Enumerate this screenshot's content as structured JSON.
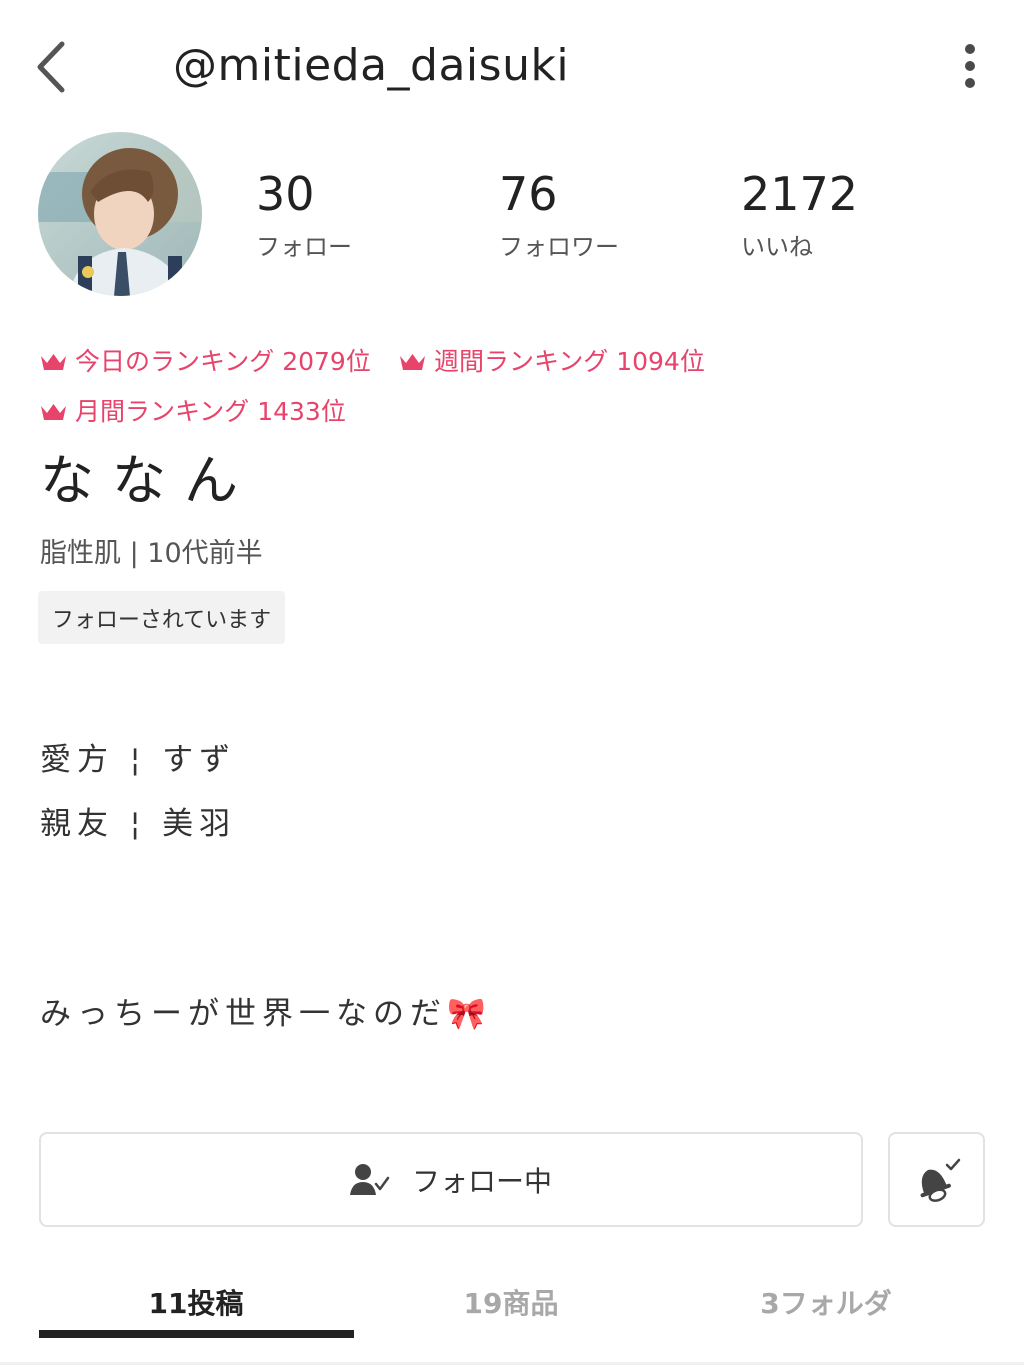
{
  "header": {
    "handle": "@mitieda_daisuki",
    "back_icon": "chevron-left-icon",
    "more_icon": "vertical-ellipsis-icon"
  },
  "profile": {
    "avatar": "profile-photo",
    "stats": [
      {
        "value": "30",
        "label": "フォロー"
      },
      {
        "value": "76",
        "label": "フォロワー"
      },
      {
        "value": "2172",
        "label": "いいね"
      }
    ],
    "rankings": [
      {
        "text": "今日のランキング 2079位",
        "icon": "crown-icon"
      },
      {
        "text": "週間ランキング 1094位",
        "icon": "crown-icon"
      },
      {
        "text": "月間ランキング 1433位",
        "icon": "crown-icon"
      }
    ],
    "name": "ななん",
    "meta": "脂性肌 | 10代前半",
    "follows_you_badge": "フォローされています",
    "bio": {
      "line1": "愛方 ¦ すず",
      "line2": "親友 ¦ 美羽",
      "line3": "みっちーが世界一なのだ🎀"
    }
  },
  "actions": {
    "follow_label": "フォロー中",
    "follow_icon": "user-check-icon",
    "bell_icon": "bell-check-icon"
  },
  "tabs": [
    {
      "label": "11投稿",
      "active": true
    },
    {
      "label": "19商品",
      "active": false
    },
    {
      "label": "3フォルダ",
      "active": false
    }
  ],
  "colors": {
    "accent_pink": "#e8436a",
    "text_dark": "#222222",
    "text_muted": "#a8a8a8"
  }
}
